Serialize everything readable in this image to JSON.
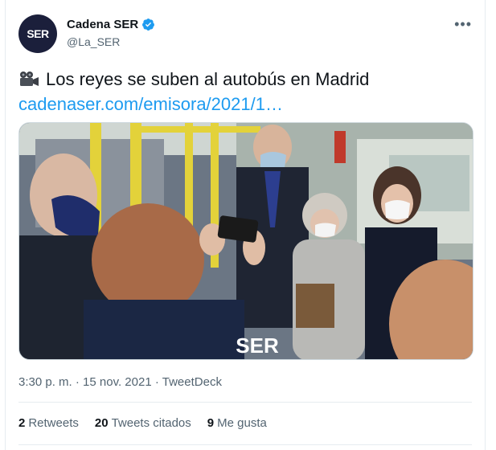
{
  "account": {
    "avatar_text": "SER",
    "name": "Cadena SER",
    "handle": "@La_SER"
  },
  "tweet": {
    "text": "Los reyes se suben al autobús en Madrid",
    "link": "cadenaser.com/emisora/2021/1…",
    "media_watermark": "SER"
  },
  "meta": {
    "time": "3:30 p. m.",
    "date": "15 nov. 2021",
    "source": "TweetDeck",
    "separator": "·"
  },
  "stats": [
    {
      "count": "2",
      "label": "Retweets"
    },
    {
      "count": "20",
      "label": "Tweets citados"
    },
    {
      "count": "9",
      "label": "Me gusta"
    }
  ],
  "colors": {
    "accent": "#1d9bf0",
    "secondary_text": "#536471",
    "border": "#e6ecf0"
  },
  "icons": {
    "verified": "verified-badge-icon",
    "more": "more-options-icon",
    "camera": "movie-camera-icon"
  }
}
